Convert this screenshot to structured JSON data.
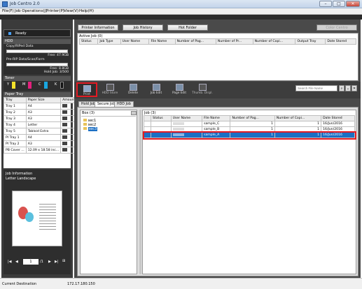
{
  "window": {
    "title": "Job Centro 2.0"
  },
  "menu": [
    "File(F)",
    "Job Operations(J)",
    "Printer(P)",
    "View(V)",
    "Help(H)"
  ],
  "status": {
    "label": "Ready"
  },
  "hdd": {
    "title": "HDD",
    "copy_label": "Copy/RIPed Data",
    "copy_free": "Free: 47.9GB",
    "prerip_label": "Pre-RIP Data/Scan/Form",
    "prerip_free": "Free: 8.8GB",
    "hold_job": "Hold Job: 3/500"
  },
  "toner": {
    "title": "Toner",
    "colors": [
      "Y",
      "M",
      "C",
      "K"
    ]
  },
  "paper_tray": {
    "title": "Paper Tray",
    "headers": [
      "Tray",
      "Paper Size",
      "Amount"
    ],
    "rows": [
      [
        "Tray 1",
        "A4"
      ],
      [
        "Tray 2",
        "A3"
      ],
      [
        "Tray 3",
        "A3"
      ],
      [
        "Tray 4",
        "Letter"
      ],
      [
        "Tray 5",
        "Tabloid Extra"
      ],
      [
        "PI Tray 1",
        "A4"
      ],
      [
        "PI Tray 2",
        "A3"
      ],
      [
        "PB Cover ...",
        "12.09 x 18.58 inc..."
      ]
    ]
  },
  "job_info": {
    "title": "Job Information",
    "paper": "Letter Landscape",
    "page": "1",
    "total": "/1"
  },
  "top_buttons": {
    "printer_info": "Printer Information",
    "job_history": "Job History",
    "hot_folder": "Hot Folder",
    "color_centro": "Color Centro"
  },
  "active_job": {
    "title": "Active Job (0)",
    "headers": [
      "Status",
      "Job Type",
      "User Name",
      "File Name",
      "Number of Pag...",
      "Number of Pr...",
      "Number of Copi...",
      "Output Tray",
      "Date Stored"
    ]
  },
  "toolbar": {
    "print": "Print",
    "hdd_store": "HDD Store",
    "delete": "Delete",
    "job_edit": "Job Edit",
    "page_edit": "Page Edit",
    "thumbnail": "Thumb. Displ.",
    "search_placeholder": "Search File Name"
  },
  "tabs": [
    "Hold Job",
    "Secure Job",
    "HDD Job"
  ],
  "box": {
    "title": "Box (3)",
    "folders": [
      "sec1",
      "sec2",
      "sec3"
    ]
  },
  "job_list": {
    "title": "Job (3)",
    "headers": [
      "",
      "Status",
      "User Name",
      "File Name",
      "Number of Pag...",
      "Number of Copi...",
      "Date Stored"
    ],
    "rows": [
      {
        "file": "sample_C",
        "pages": "1",
        "copies": "1",
        "date": "16/Jun/2016"
      },
      {
        "file": "sample_B",
        "pages": "1",
        "copies": "1",
        "date": "16/Jun/2016"
      },
      {
        "file": "sample_A",
        "pages": "1",
        "copies": "1",
        "date": "16/Jun/2016"
      }
    ]
  },
  "statusbar": {
    "label": "Current Destination",
    "ip": "172.17.180.150"
  },
  "colors": {
    "selected_row": "#1b6fc4",
    "highlight": "#e31b23"
  }
}
